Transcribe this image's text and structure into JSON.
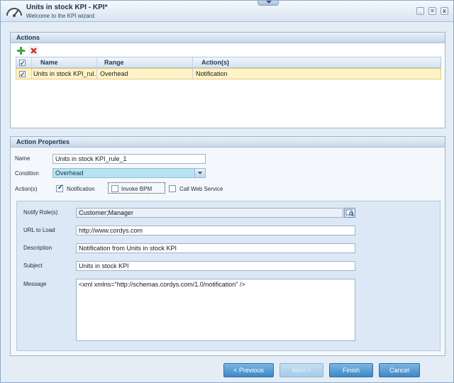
{
  "window": {
    "title": "Units in stock KPI - KPI*",
    "subtitle": "Welcome to the KPI wizard",
    "controls": [
      "_",
      "=",
      "x"
    ]
  },
  "actions_panel": {
    "title": "Actions",
    "columns": [
      "Name",
      "Range",
      "Action(s)"
    ],
    "rows": [
      {
        "checked": true,
        "name": "Units in stock KPI_rul...",
        "range": "Overhead",
        "actions": "Notification"
      }
    ]
  },
  "properties_panel": {
    "title": "Action Properties",
    "name_label": "Name",
    "name_value": "Units in stock KPI_rule_1",
    "condition_label": "Condition",
    "condition_value": "Overhead",
    "actions_label": "Action(s)",
    "action_options": [
      {
        "label": "Notification",
        "checked": true
      },
      {
        "label": "Invoke BPM",
        "checked": false
      },
      {
        "label": "Call Web Service",
        "checked": false
      }
    ]
  },
  "notification": {
    "notify_roles_label": "Notify Role(s)",
    "notify_roles_value": "Customer;Manager",
    "url_label": "URL to Load",
    "url_value": "http://www.cordys.com",
    "description_label": "Description",
    "description_value": "Notification from Units in stock KPI",
    "subject_label": "Subject",
    "subject_value": "Units in stock KPI",
    "message_label": "Message",
    "message_value": "<xml xmlns=\"http://schemas.cordys.com/1.0/notification\" />"
  },
  "footer": {
    "previous": "< Previous",
    "next": "Next >",
    "finish": "Finish",
    "cancel": "Cancel"
  }
}
